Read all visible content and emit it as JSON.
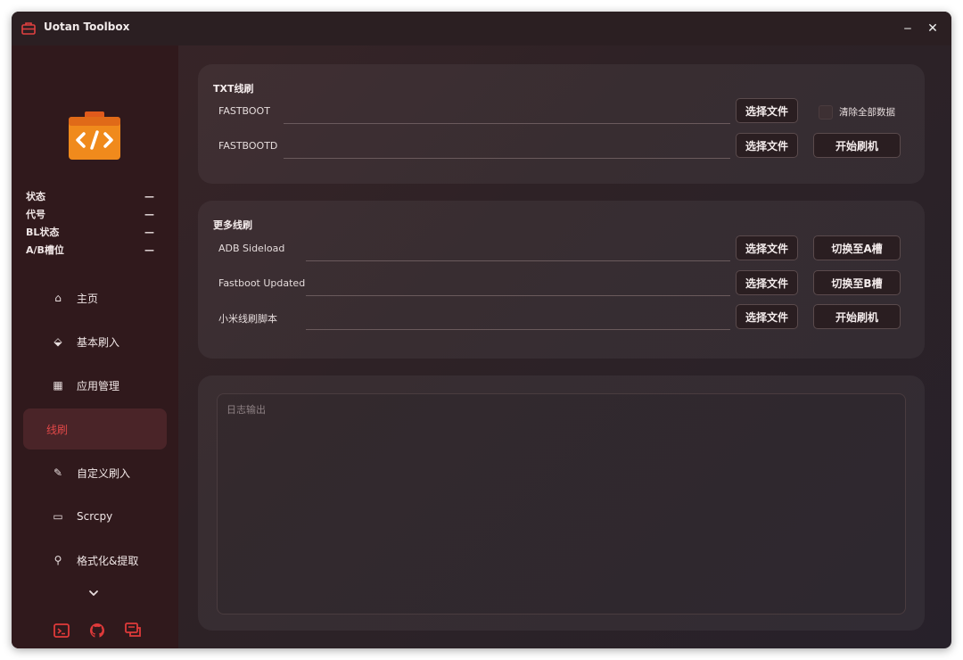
{
  "window": {
    "title": "Uotan Toolbox",
    "minimize_glyph": "‒",
    "close_glyph": "✕"
  },
  "sidebar": {
    "info": [
      {
        "label": "状态",
        "value": "—"
      },
      {
        "label": "代号",
        "value": "—"
      },
      {
        "label": "BL状态",
        "value": "—"
      },
      {
        "label": "A/B槽位",
        "value": "—"
      }
    ],
    "nav": [
      {
        "label": "主页",
        "icon": "home-icon",
        "glyph": "⌂"
      },
      {
        "label": "基本刷入",
        "icon": "flash-icon",
        "glyph": "⬙"
      },
      {
        "label": "应用管理",
        "icon": "apps-icon",
        "glyph": "▦"
      },
      {
        "label": "线刷",
        "icon": "",
        "glyph": "",
        "active": true
      },
      {
        "label": "自定义刷入",
        "icon": "wand-icon",
        "glyph": "✎"
      },
      {
        "label": "Scrcpy",
        "icon": "screen-mirror-icon",
        "glyph": "▭"
      },
      {
        "label": "格式化&提取",
        "icon": "format-icon",
        "glyph": "⚲"
      }
    ],
    "bottom_icons": [
      "terminal-icon",
      "github-icon",
      "feedback-icon"
    ]
  },
  "txt_flash": {
    "title": "TXT线刷",
    "fastboot_label": "FASTBOOT",
    "fastbootd_label": "FASTBOOTD",
    "select_file_1": "选择文件",
    "select_file_2": "选择文件",
    "clear_all_label": "清除全部数据",
    "start_flash": "开始刷机"
  },
  "more_flash": {
    "title": "更多线刷",
    "adb_label": "ADB Sideload",
    "fastboot_updated_label": "Fastboot Updated",
    "xiaomi_label": "小米线刷脚本",
    "select_file_1": "选择文件",
    "select_file_2": "选择文件",
    "select_file_3": "选择文件",
    "switch_a": "切换至A槽",
    "switch_b": "切换至B槽",
    "start_flash": "开始刷机"
  },
  "log": {
    "placeholder": "日志输出"
  },
  "colors": {
    "accent": "#e04848",
    "sidebar_bg": "#30191c",
    "active_nav_bg": "#4a2428"
  }
}
